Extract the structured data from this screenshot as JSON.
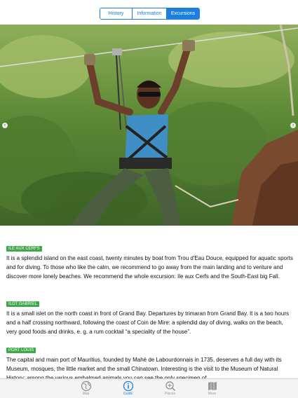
{
  "segments": {
    "history": "History",
    "information": "Information",
    "excursions": "Excursions",
    "selected": "Excursions"
  },
  "photo": {
    "description_icon": "zipline-photo"
  },
  "sections": [
    {
      "tag": "ILE AUX CERFS",
      "text": "It is a splendid island on the east coast, twenty minutes by boat from Trou d'Eau Douce, equipped for aquatic sports and for diving. To those who like the calm, we recommend to go away from the main landing and to venture and discover more lonely beaches. We recommend the whole excursion: Ile aux Cerfs and the South-East big Fall."
    },
    {
      "tag": "ILÔT GABRIEL",
      "text": "It is a small islet on the north coast in front of Grand Bay. Departures by trimaran from Grand Bay. It is a two hours and a half crossing northward, following the coast of Coin de Mire: a splendid day of diving, walks on the beach, very good foods and drinks, e. g. a rum cocktail “a speciality of the house”."
    },
    {
      "tag": "PORT LOUIS",
      "text": "The capital and main port of Mauritius, founded by Mahé de Labourdonnais in 1735, deserves a full day with its Museum, mosques, the little market and the small Chinatown. Interesting is the visit to the Museum of Natural History: among the various embalmed animals you can see the only specimen of"
    }
  ],
  "tabbar": {
    "map": "Map",
    "guide": "Guide",
    "places": "Places",
    "more": "More",
    "active": "Guide"
  },
  "colors": {
    "accent": "#1b7ee0",
    "tag_green": "#3ea84a"
  }
}
